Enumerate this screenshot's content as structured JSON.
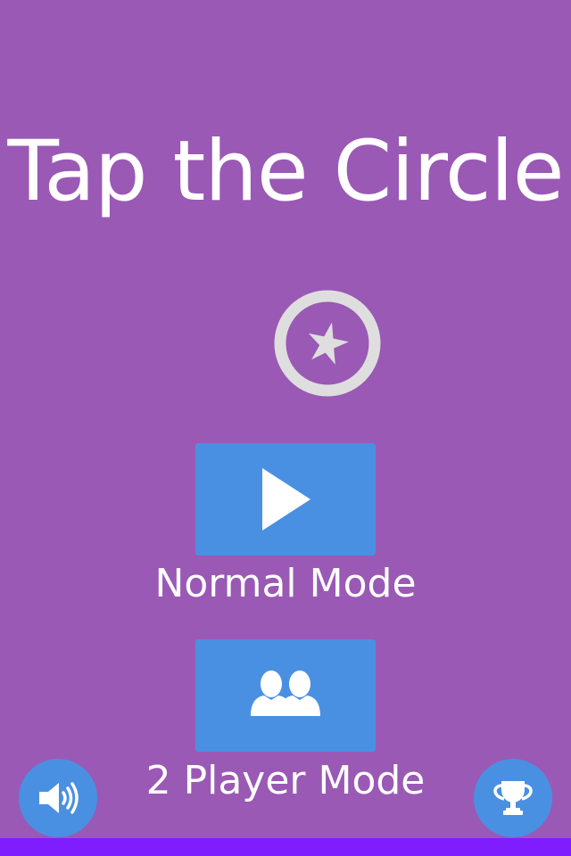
{
  "game": {
    "title": "Tap the Circle"
  },
  "menu": {
    "normal_mode_label": "Normal Mode",
    "two_player_mode_label": "2 Player Mode"
  },
  "icons": {
    "badge": "star-in-circle-icon",
    "normal_mode": "play-icon",
    "two_player_mode": "two-users-icon",
    "sound": "speaker-icon",
    "leaderboard": "trophy-icon"
  },
  "colors": {
    "background": "#9a59b5",
    "button": "#4a90e2",
    "badge": "#dedede",
    "bottom_bar": "#7f1dff"
  }
}
